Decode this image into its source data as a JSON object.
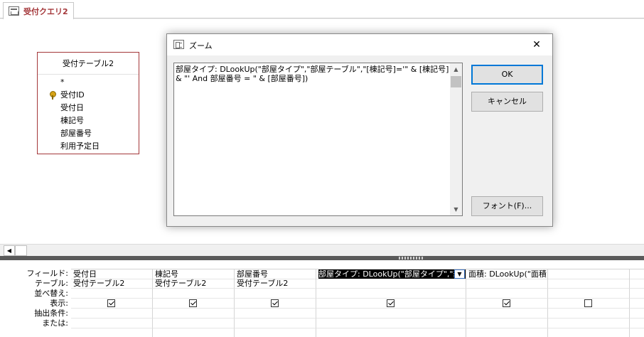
{
  "tab": {
    "label": "受付クエリ2"
  },
  "table": {
    "title": "受付テーブル2",
    "fields": [
      {
        "name": "*",
        "key": false
      },
      {
        "name": "受付ID",
        "key": true
      },
      {
        "name": "受付日",
        "key": false
      },
      {
        "name": "棟記号",
        "key": false
      },
      {
        "name": "部屋番号",
        "key": false
      },
      {
        "name": "利用予定日",
        "key": false
      }
    ]
  },
  "grid": {
    "row_headers": [
      "フィールド:",
      "テーブル:",
      "並べ替え:",
      "表示:",
      "抽出条件:",
      "または:"
    ],
    "columns": [
      {
        "field": "受付日",
        "table": "受付テーブル2",
        "show": true
      },
      {
        "field": "棟記号",
        "table": "受付テーブル2",
        "show": true
      },
      {
        "field": "部屋番号",
        "table": "受付テーブル2",
        "show": true
      },
      {
        "field": "部屋タイプ: DLookUp(\"部屋タイプ\",\"部",
        "table": "",
        "show": true,
        "selected": true
      },
      {
        "field": "面積: DLookUp(\"面積",
        "table": "",
        "show": true
      },
      {
        "field": "",
        "table": "",
        "show": false
      }
    ]
  },
  "dialog": {
    "title": "ズーム",
    "close_glyph": "✕",
    "text": "部屋タイプ: DLookUp(\"部屋タイプ\",\"部屋テーブル\",\"[棟記号]='\" & [棟記号] & \"' And 部屋番号 = \" & [部屋番号])",
    "ok_label": "OK",
    "cancel_label": "キャンセル",
    "font_label": "フォント(F)..."
  }
}
